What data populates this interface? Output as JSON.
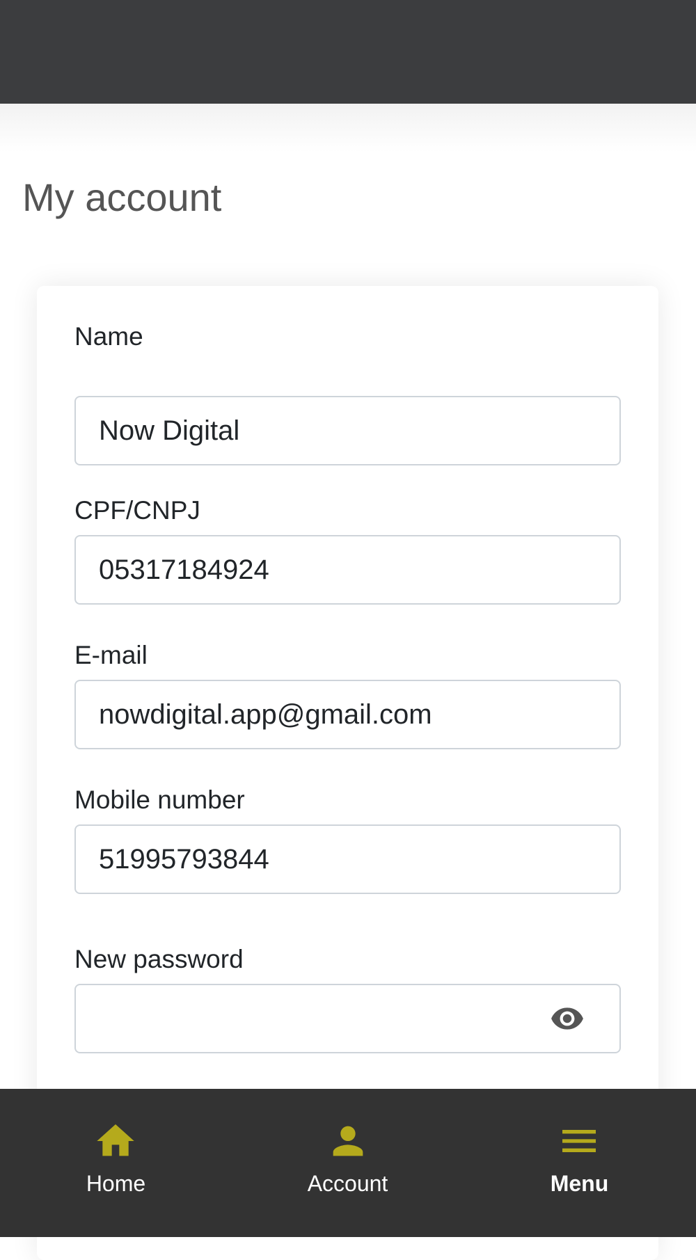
{
  "header": {
    "background": "#3c3d3f"
  },
  "page": {
    "title": "My account"
  },
  "form": {
    "name": {
      "label": "Name",
      "value": "Now Digital"
    },
    "document": {
      "label": "CPF/CNPJ",
      "value": "05317184924"
    },
    "email": {
      "label": "E-mail",
      "value": "nowdigital.app@gmail.com"
    },
    "mobile": {
      "label": "Mobile number",
      "value": "51995793844"
    },
    "password": {
      "label": "New password",
      "value": "",
      "toggle_icon": "eye-icon"
    }
  },
  "nav": {
    "accent": "#b5aa1c",
    "items": [
      {
        "label": "Home",
        "icon": "home-icon",
        "active": false
      },
      {
        "label": "Account",
        "icon": "user-icon",
        "active": false
      },
      {
        "label": "Menu",
        "icon": "hamburger-menu-icon",
        "active": true
      }
    ]
  }
}
